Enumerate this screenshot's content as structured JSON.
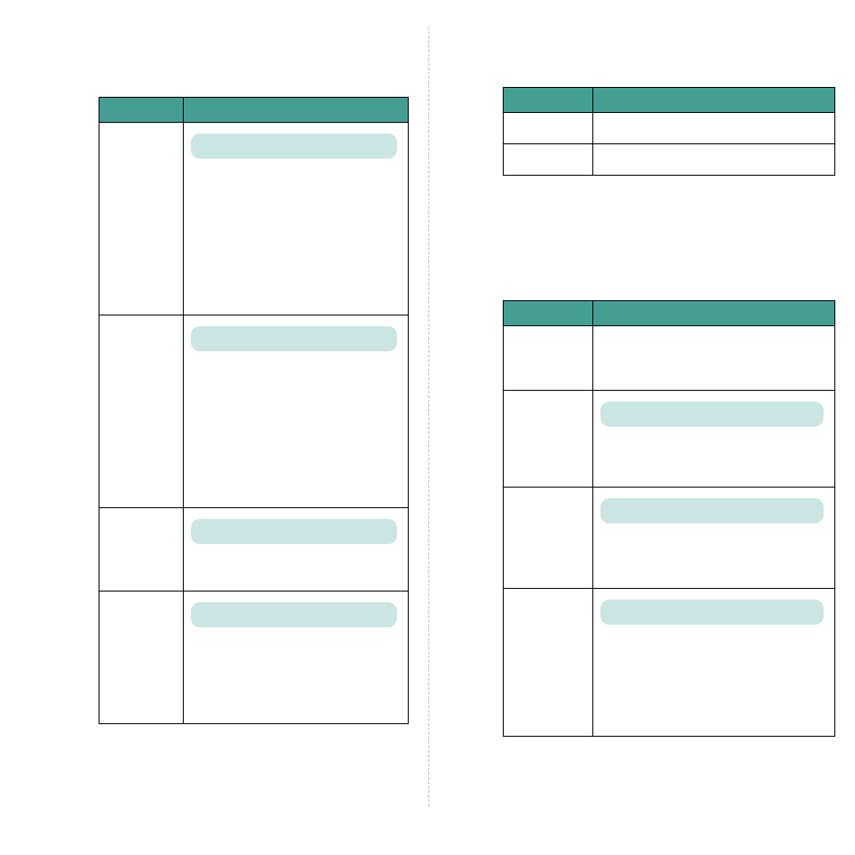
{
  "colors": {
    "header": "#459e94",
    "pill": "#cbe5e2"
  },
  "leftTable": {
    "headers": [
      "",
      ""
    ],
    "rows": [
      {
        "label": "",
        "hasPill": true
      },
      {
        "label": "",
        "hasPill": true
      },
      {
        "label": "",
        "hasPill": true
      },
      {
        "label": "",
        "hasPill": true
      }
    ]
  },
  "rightSmallTable": {
    "headers": [
      "",
      ""
    ],
    "rows": [
      {
        "c1": "",
        "c2": ""
      },
      {
        "c1": "",
        "c2": ""
      }
    ]
  },
  "rightLargeTable": {
    "headers": [
      "",
      ""
    ],
    "rows": [
      {
        "label": "",
        "hasPill": false
      },
      {
        "label": "",
        "hasPill": true
      },
      {
        "label": "",
        "hasPill": true
      },
      {
        "label": "",
        "hasPill": true
      }
    ]
  }
}
